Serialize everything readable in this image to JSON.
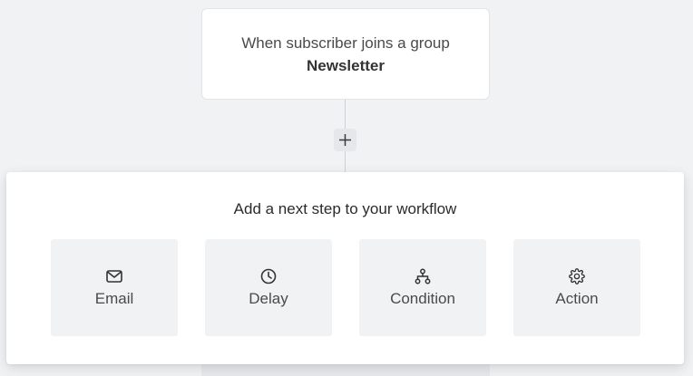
{
  "trigger": {
    "text": "When subscriber joins a group",
    "group_name": "Newsletter"
  },
  "add_step_icon": "plus-icon",
  "panel": {
    "title": "Add a next step to your workflow",
    "options": [
      {
        "label": "Email",
        "icon": "envelope-icon"
      },
      {
        "label": "Delay",
        "icon": "clock-icon"
      },
      {
        "label": "Condition",
        "icon": "branch-icon"
      },
      {
        "label": "Action",
        "icon": "gear-icon"
      }
    ]
  },
  "colors": {
    "background": "#f1f2f4",
    "card": "#ffffff",
    "option_bg": "#f1f2f4",
    "text": "#3a3a3a"
  }
}
